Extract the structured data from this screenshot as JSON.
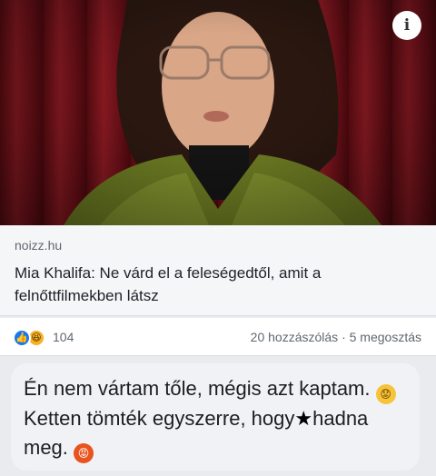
{
  "post": {
    "link": {
      "domain": "noizz.hu",
      "headline": "Mia Khalifa: Ne várd el a feleségedtől, amit a felnőttfilmekben látsz"
    },
    "reactions": {
      "count": "104",
      "comments": "20 hozzászólás",
      "separator": "·",
      "shares": "5 megosztás"
    }
  },
  "comment": {
    "part1": "Én nem vártam tőle, mégis azt kaptam.",
    "part2": "Ketten tömték egyszerre, hogy",
    "censored": "★",
    "part3": "hadna meg."
  },
  "icons": {
    "info": "info-icon",
    "like": "like-reaction-icon",
    "haha": "haha-reaction-icon",
    "sad": "sad-emoji-icon",
    "angry": "angry-emoji-icon"
  }
}
